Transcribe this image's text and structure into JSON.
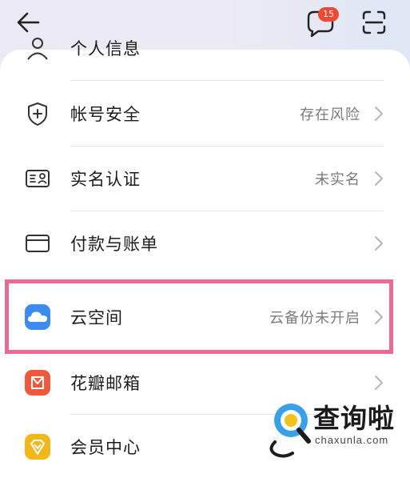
{
  "header": {
    "back_icon": "arrow-left-icon",
    "message_icon": "chat-bubble-icon",
    "message_count": "15",
    "scan_icon": "scan-icon"
  },
  "list": {
    "partial_item_label": "个人信息",
    "items": [
      {
        "label": "帐号安全",
        "value": "存在风险",
        "icon": "shield-plus-icon"
      },
      {
        "label": "实名认证",
        "value": "未实名",
        "icon": "id-card-icon"
      },
      {
        "label": "付款与账单",
        "value": "",
        "icon": "card-icon"
      },
      {
        "label": "云空间",
        "value": "云备份未开启",
        "icon": "cloud-icon"
      },
      {
        "label": "花瓣邮箱",
        "value": "",
        "icon": "mail-icon"
      },
      {
        "label": "会员中心",
        "value": "",
        "icon": "member-icon"
      }
    ]
  },
  "watermark": {
    "title": "查询啦",
    "subtitle": "chaxunla.com"
  },
  "colors": {
    "highlight": "#e96a97",
    "badge": "#f04a32",
    "cloud": "#3c8cf0",
    "mail": "#ef5a3c",
    "member": "#f2b81a"
  }
}
